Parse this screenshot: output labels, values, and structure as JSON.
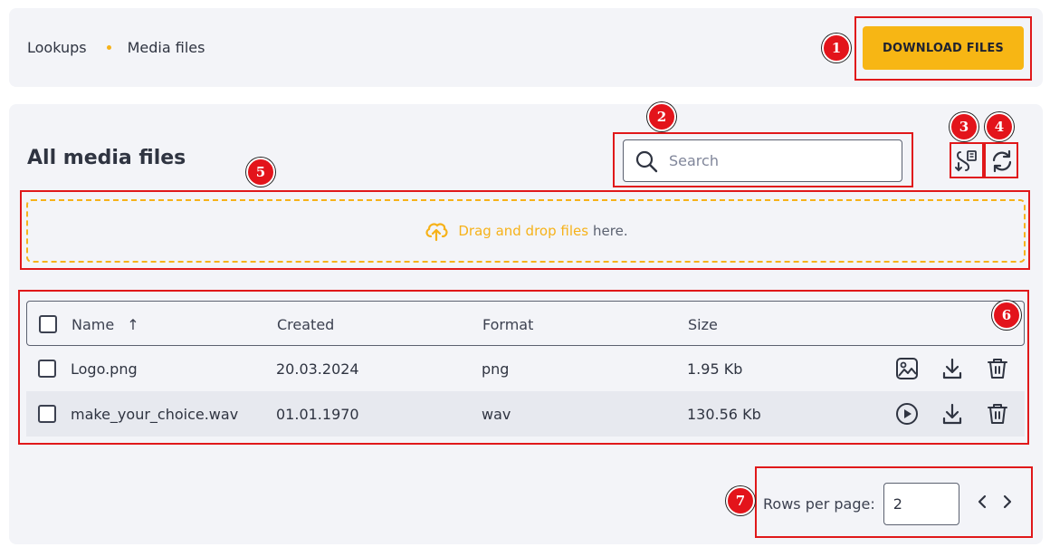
{
  "breadcrumb": {
    "items": [
      "Lookups",
      "Media files"
    ]
  },
  "header": {
    "download_label": "DOWNLOAD FILES"
  },
  "main": {
    "title": "All media files",
    "search": {
      "placeholder": "Search",
      "value": ""
    },
    "dropzone": {
      "highlight": "Drag and drop files",
      "rest": "here."
    }
  },
  "table": {
    "columns": {
      "name": "Name",
      "sort_indicator": "↑",
      "created": "Created",
      "format": "Format",
      "size": "Size"
    },
    "rows": [
      {
        "name": "Logo.png",
        "created": "20.03.2024",
        "format": "png",
        "size": "1.95 Kb",
        "preview_icon": "image-icon"
      },
      {
        "name": "make_your_choice.wav",
        "created": "01.01.1970",
        "format": "wav",
        "size": "130.56 Kb",
        "preview_icon": "play-icon"
      }
    ]
  },
  "pagination": {
    "rows_per_page_label": "Rows per page:",
    "rows_per_page_value": "2"
  },
  "annotations": [
    "1",
    "2",
    "3",
    "4",
    "5",
    "6",
    "7"
  ],
  "colors": {
    "accent": "#f7b614",
    "highlight_box": "#e0181a",
    "row_alt": "#e7e9ef"
  }
}
